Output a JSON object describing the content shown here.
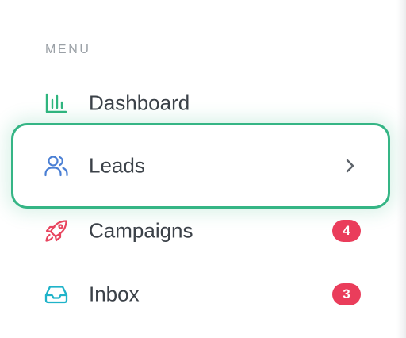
{
  "sidebar": {
    "section_label": "MENU",
    "items": [
      {
        "label": "Dashboard",
        "icon": "bar-chart-icon",
        "icon_color": "#2fb57e",
        "active": false
      },
      {
        "label": "Leads",
        "icon": "users-icon",
        "icon_color": "#4a7fd4",
        "active": true
      },
      {
        "label": "Campaigns",
        "icon": "rocket-icon",
        "icon_color": "#e8455f",
        "active": false,
        "badge": "4"
      },
      {
        "label": "Inbox",
        "icon": "inbox-icon",
        "icon_color": "#1fb3c9",
        "active": false,
        "badge": "3"
      }
    ]
  },
  "colors": {
    "active_border": "#35b585",
    "badge_bg": "#ea3d5b",
    "label_text": "#3b4148",
    "section_label_text": "#9aa0a6"
  }
}
